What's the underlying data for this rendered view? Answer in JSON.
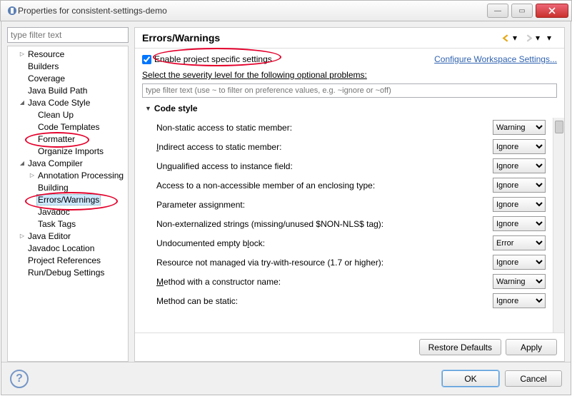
{
  "window": {
    "title": "Properties for consistent-settings-demo"
  },
  "sidebar": {
    "filter_placeholder": "type filter text",
    "items": [
      {
        "label": "Resource",
        "depth": 1,
        "tw": "▷"
      },
      {
        "label": "Builders",
        "depth": 1,
        "tw": ""
      },
      {
        "label": "Coverage",
        "depth": 1,
        "tw": ""
      },
      {
        "label": "Java Build Path",
        "depth": 1,
        "tw": ""
      },
      {
        "label": "Java Code Style",
        "depth": 1,
        "tw": "◢"
      },
      {
        "label": "Clean Up",
        "depth": 2,
        "tw": ""
      },
      {
        "label": "Code Templates",
        "depth": 2,
        "tw": ""
      },
      {
        "label": "Formatter",
        "depth": 2,
        "tw": ""
      },
      {
        "label": "Organize Imports",
        "depth": 2,
        "tw": ""
      },
      {
        "label": "Java Compiler",
        "depth": 1,
        "tw": "◢"
      },
      {
        "label": "Annotation Processing",
        "depth": 2,
        "tw": "▷"
      },
      {
        "label": "Building",
        "depth": 2,
        "tw": ""
      },
      {
        "label": "Errors/Warnings",
        "depth": 2,
        "tw": "",
        "selected": true
      },
      {
        "label": "Javadoc",
        "depth": 2,
        "tw": ""
      },
      {
        "label": "Task Tags",
        "depth": 2,
        "tw": ""
      },
      {
        "label": "Java Editor",
        "depth": 1,
        "tw": "▷"
      },
      {
        "label": "Javadoc Location",
        "depth": 1,
        "tw": ""
      },
      {
        "label": "Project References",
        "depth": 1,
        "tw": ""
      },
      {
        "label": "Run/Debug Settings",
        "depth": 1,
        "tw": ""
      }
    ]
  },
  "page": {
    "title": "Errors/Warnings",
    "enable_label": "Enable project specific settings",
    "enable_checked": true,
    "workspace_link": "Configure Workspace Settings...",
    "desc": "Select the severity level for the following optional problems:",
    "filter_placeholder": "type filter text (use ~ to filter on preference values, e.g. ~ignore or ~off)",
    "section": "Code style",
    "severities": [
      "Ignore",
      "Warning",
      "Error"
    ],
    "options": [
      {
        "label": "Non-static access to static member:",
        "value": "Warning"
      },
      {
        "label": "Indirect access to static member:",
        "value": "Ignore",
        "u": 0
      },
      {
        "label": "Unqualified access to instance field:",
        "value": "Ignore",
        "u": 2
      },
      {
        "label": "Access to a non-accessible member of an enclosing type:",
        "value": "Ignore"
      },
      {
        "label": "Parameter assignment:",
        "value": "Ignore"
      },
      {
        "label": "Non-externalized strings (missing/unused $NON-NLS$ tag):",
        "value": "Ignore"
      },
      {
        "label": "Undocumented empty block:",
        "value": "Error",
        "u": 20
      },
      {
        "label": "Resource not managed via try-with-resource (1.7 or higher):",
        "value": "Ignore"
      },
      {
        "label": "Method with a constructor name:",
        "value": "Warning",
        "u": 0
      },
      {
        "label": "Method can be static:",
        "value": "Ignore"
      }
    ],
    "restore": "Restore Defaults",
    "apply": "Apply"
  },
  "footer": {
    "ok": "OK",
    "cancel": "Cancel"
  }
}
